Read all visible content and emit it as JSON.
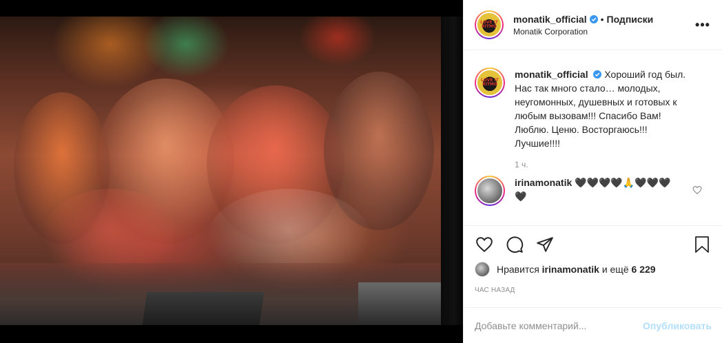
{
  "header": {
    "username": "monatik_official",
    "separator": "•",
    "follow_label": "Подписки",
    "subtitle": "Monatik Corporation",
    "avatar_logo_text": "LOVE IT RITMO",
    "more_label": "•••"
  },
  "caption": {
    "username": "monatik_official",
    "text": "Хороший год был. Нас так много стало… молодых, неугомонных, душевных и готовых к любым вызовам!!! Спасибо Вам! Люблю. Ценю. Восторгаюсь!!! Лучшие!!!!",
    "time": "1 ч."
  },
  "reply": {
    "username": "irinamonatik",
    "text": "🖤🖤🖤🖤🙏🖤🖤🖤🖤"
  },
  "likes": {
    "prefix": "Нравится",
    "liked_by": "irinamonatik",
    "and_more": "и ещё",
    "count": "6 229"
  },
  "timestamp": "Час назад",
  "add_comment": {
    "placeholder": "Добавьте комментарий...",
    "post_label": "Опубликовать"
  },
  "icons": [
    "heart-icon",
    "comment-icon",
    "share-icon",
    "bookmark-icon",
    "verified-icon",
    "more-icon"
  ],
  "colors": {
    "verified": "#3897f0",
    "post_button_disabled": "#b2dffc",
    "muted": "#8e8e8e"
  }
}
